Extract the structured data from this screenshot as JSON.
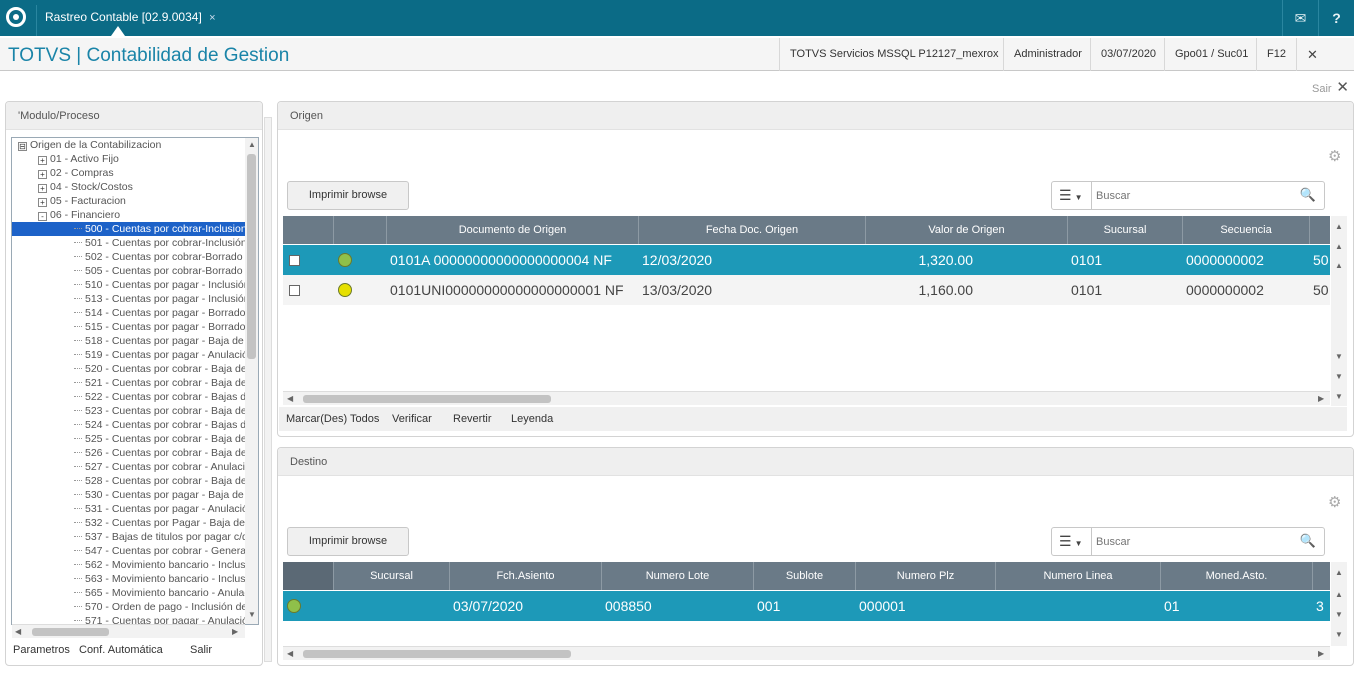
{
  "topbar": {
    "tab_label": "Rastreo Contable [02.9.0034]",
    "tab_close": "×",
    "mail_icon": "✉",
    "help_icon": "?"
  },
  "header": {
    "app_title": "TOTVS | Contabilidad de Gestion",
    "server": "TOTVS Servicios MSSQL P12127_mexrox",
    "user": "Administrador",
    "date": "03/07/2020",
    "branch": "Gpo01 / Suc01",
    "hotkey": "F12",
    "exit_label": "Sair",
    "exit_icon": "✕"
  },
  "close_icon": "✕",
  "left_panel": {
    "title": "'Modulo/Proceso",
    "tree": [
      {
        "label": "Origen de la Contabilizacion",
        "level": 0,
        "expander": "⊟"
      },
      {
        "label": "01 - Activo Fijo",
        "level": 1,
        "expander": "+"
      },
      {
        "label": "02 - Compras",
        "level": 1,
        "expander": "+"
      },
      {
        "label": "04 - Stock/Costos",
        "level": 1,
        "expander": "+"
      },
      {
        "label": "05 - Facturacion",
        "level": 1,
        "expander": "+"
      },
      {
        "label": "06 - Financiero",
        "level": 1,
        "expander": "-"
      },
      {
        "label": "500 - Cuentas por cobrar-Inclusion",
        "level": 2,
        "selected": true
      },
      {
        "label": "501 - Cuentas por cobrar-Inclusión",
        "level": 2
      },
      {
        "label": "502 - Cuentas por cobrar-Borrado c",
        "level": 2
      },
      {
        "label": "505 - Cuentas por cobrar-Borrado c",
        "level": 2
      },
      {
        "label": "510 - Cuentas por pagar - Inclusión",
        "level": 2
      },
      {
        "label": "513 - Cuentas por pagar - Inclusión",
        "level": 2
      },
      {
        "label": "514 - Cuentas por pagar - Borrado",
        "level": 2
      },
      {
        "label": "515 - Cuentas por pagar - Borrado",
        "level": 2
      },
      {
        "label": "518 - Cuentas por pagar - Baja de t",
        "level": 2
      },
      {
        "label": "519 - Cuentas por pagar - Anulació",
        "level": 2
      },
      {
        "label": "520 - Cuentas por cobrar - Baja de",
        "level": 2
      },
      {
        "label": "521 - Cuentas por cobrar - Baja de",
        "level": 2
      },
      {
        "label": "522 - Cuentas por cobrar - Bajas d",
        "level": 2
      },
      {
        "label": "523 - Cuentas por cobrar - Baja de",
        "level": 2
      },
      {
        "label": "524 - Cuentas por cobrar - Bajas d",
        "level": 2
      },
      {
        "label": "525 - Cuentas por cobrar - Baja de",
        "level": 2
      },
      {
        "label": "526 - Cuentas por cobrar - Baja de",
        "level": 2
      },
      {
        "label": "527 - Cuentas por cobrar - Anulació",
        "level": 2
      },
      {
        "label": "528 - Cuentas por cobrar - Baja de",
        "level": 2
      },
      {
        "label": "530 - Cuentas por pagar - Baja de t",
        "level": 2
      },
      {
        "label": "531 - Cuentas por pagar - Anulació",
        "level": 2
      },
      {
        "label": "532 - Cuentas por Pagar - Baja de t",
        "level": 2
      },
      {
        "label": "537 - Bajas de titulos por pagar c/d",
        "level": 2
      },
      {
        "label": "547 - Cuentas por cobrar - Genera",
        "level": 2
      },
      {
        "label": "562 - Movimiento bancario - Inclusió",
        "level": 2
      },
      {
        "label": "563 - Movimiento bancario - Inclusió",
        "level": 2
      },
      {
        "label": "565 - Movimiento bancario - Anulac",
        "level": 2
      },
      {
        "label": "570 - Orden de pago - Inclusión de",
        "level": 2
      },
      {
        "label": "571 - Cuentas por pagar - Anulació",
        "level": 2
      }
    ],
    "footer": [
      "Parametros",
      "Conf. Automática",
      "Salir"
    ]
  },
  "origen": {
    "title": "Origen",
    "print_button": "Imprimir browse",
    "search_placeholder": "Buscar",
    "columns": [
      "Documento de Origen",
      "Fecha Doc. Origen",
      "Valor de Origen",
      "Sucursal",
      "Secuencia"
    ],
    "rows": [
      {
        "doc": "0101A  00000000000000000004  NF",
        "fecha": "12/03/2020",
        "valor": "1,320.00",
        "sucursal": "0101",
        "secuencia": "0000000002",
        "extra": "50",
        "status_color": "#8fc04a",
        "selected": true
      },
      {
        "doc": "0101UNI00000000000000000001  NF",
        "fecha": "13/03/2020",
        "valor": "1,160.00",
        "sucursal": "0101",
        "secuencia": "0000000002",
        "extra": "50",
        "status_color": "#e6e000",
        "selected": false
      }
    ],
    "footer": [
      "Marcar(Des) Todos",
      "Verificar",
      "Revertir",
      "Leyenda"
    ]
  },
  "destino": {
    "title": "Destino",
    "print_button": "Imprimir browse",
    "search_placeholder": "Buscar",
    "columns": [
      "Sucursal",
      "Fch.Asiento",
      "Numero Lote",
      "Sublote",
      "Numero Plz",
      "Numero Linea",
      "Moned.Asto."
    ],
    "rows": [
      {
        "sucursal": "",
        "fecha": "03/07/2020",
        "lote": "008850",
        "sublote": "001",
        "plz": "000001",
        "linea": "01",
        "moneda": "3",
        "status_color": "#8fc04a"
      }
    ]
  },
  "colors": {
    "accent": "#0b6b86",
    "title": "#1a84a8",
    "selected_row": "#1d99b8",
    "grid_header": "#6a7a87",
    "tree_selected": "#1d62c8"
  }
}
